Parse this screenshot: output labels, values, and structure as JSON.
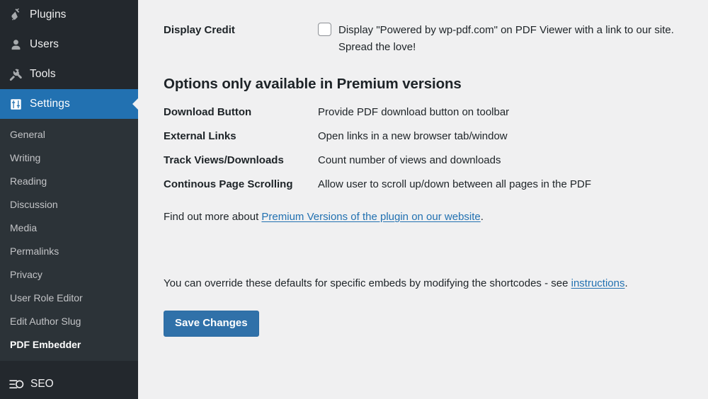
{
  "sidebar": {
    "top_items": [
      {
        "label": "Plugins",
        "icon": "plug-icon",
        "current": false
      },
      {
        "label": "Users",
        "icon": "user-icon",
        "current": false
      },
      {
        "label": "Tools",
        "icon": "wrench-icon",
        "current": false
      },
      {
        "label": "Settings",
        "icon": "settings-sliders-icon",
        "current": true
      }
    ],
    "submenu": [
      {
        "label": "General",
        "active": false
      },
      {
        "label": "Writing",
        "active": false
      },
      {
        "label": "Reading",
        "active": false
      },
      {
        "label": "Discussion",
        "active": false
      },
      {
        "label": "Media",
        "active": false
      },
      {
        "label": "Permalinks",
        "active": false
      },
      {
        "label": "Privacy",
        "active": false
      },
      {
        "label": "User Role Editor",
        "active": false
      },
      {
        "label": "Edit Author Slug",
        "active": false
      },
      {
        "label": "PDF Embedder",
        "active": true
      }
    ],
    "seo": {
      "label": "SEO",
      "icon": "yoast-seo-icon"
    },
    "colors": {
      "background": "#23282d",
      "submenu_background": "#2c3338",
      "current_highlight": "#2271b1"
    }
  },
  "main": {
    "display_credit": {
      "label": "Display Credit",
      "checkbox_checked": false,
      "description": "Display \"Powered by wp-pdf.com\" on PDF Viewer with a link to our site. Spread the love!"
    },
    "premium_section": {
      "title": "Options only available in Premium versions",
      "options": [
        {
          "name": "Download Button",
          "description": "Provide PDF download button on toolbar"
        },
        {
          "name": "External Links",
          "description": "Open links in a new browser tab/window"
        },
        {
          "name": "Track Views/Downloads",
          "description": "Count number of views and downloads"
        },
        {
          "name": "Continous Page Scrolling",
          "description": "Allow user to scroll up/down between all pages in the PDF"
        }
      ],
      "find_out_prefix": "Find out more about ",
      "find_out_link": "Premium Versions of the plugin on our website",
      "find_out_suffix": "."
    },
    "override_note": {
      "prefix": "You can override these defaults for specific embeds by modifying the shortcodes - see ",
      "link": "instructions",
      "suffix": "."
    },
    "save_button": "Save Changes",
    "colors": {
      "background": "#f0f0f1",
      "link": "#2271b1",
      "button": "#3071a9",
      "text": "#1d2327"
    }
  }
}
